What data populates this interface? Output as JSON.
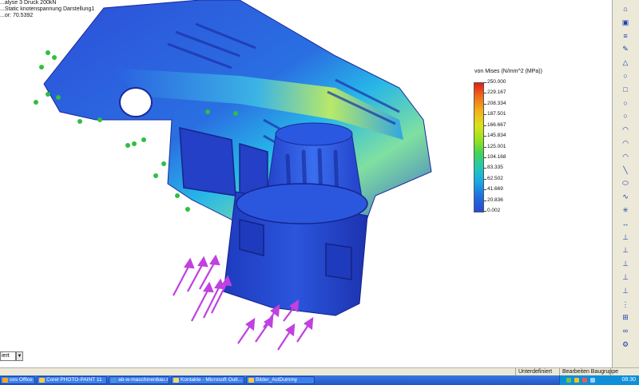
{
  "viewport_info": {
    "line1": "...alyse 3 Druck 200kN",
    "line2": "...Static knotenspannung Darstellung1",
    "line3": "...or: 70.5392"
  },
  "legend": {
    "title": "von Mises (N/mm^2 (MPa))",
    "values": [
      "250.000",
      "229.167",
      "208.334",
      "187.501",
      "166.667",
      "145.834",
      "125.001",
      "104.168",
      "83.335",
      "62.502",
      "41.669",
      "20.836",
      "0.002"
    ]
  },
  "toolbar_icons": [
    "home-icon",
    "save-icon",
    "list-icon",
    "pencil-icon",
    "triangle-icon",
    "circle-icon",
    "rectangle-icon",
    "circle-icon",
    "circle-icon",
    "arc-icon",
    "arc-icon",
    "arc-icon",
    "line-icon",
    "ellipse-icon",
    "spline-icon",
    "point-icon",
    "dimension-icon",
    "constraint-icon",
    "constraint-icon",
    "constraint-icon",
    "constraint-icon",
    "constraint-icon",
    "symmetry-icon",
    "pattern-icon",
    "link-icon",
    "settings-icon"
  ],
  "view_selector": {
    "value": "iert"
  },
  "statusbar": {
    "mode": "Unterdefiniert",
    "editing": "Bearbeiten Baugruppe"
  },
  "taskbar": {
    "items": [
      {
        "label": "ces Office Pro...",
        "color": "#f5a623"
      },
      {
        "label": "Corel PHOTO-PAINT 11",
        "color": "#f7c948"
      },
      {
        "label": "ab-w-maschinenbau.rtf ...",
        "color": "#4a90e2"
      },
      {
        "label": "Kontakte - Microsoft Outl...",
        "color": "#f5d76e"
      },
      {
        "label": "Bilder_ActDummy",
        "color": "#f7c948"
      }
    ],
    "time": "08:30"
  },
  "colors": {
    "accent": "#1f56c5",
    "stress_low": "#2a49d6",
    "stress_high": "#e51b1b",
    "load_arrow": "#c040e0",
    "constraint": "#2fbf3f"
  }
}
